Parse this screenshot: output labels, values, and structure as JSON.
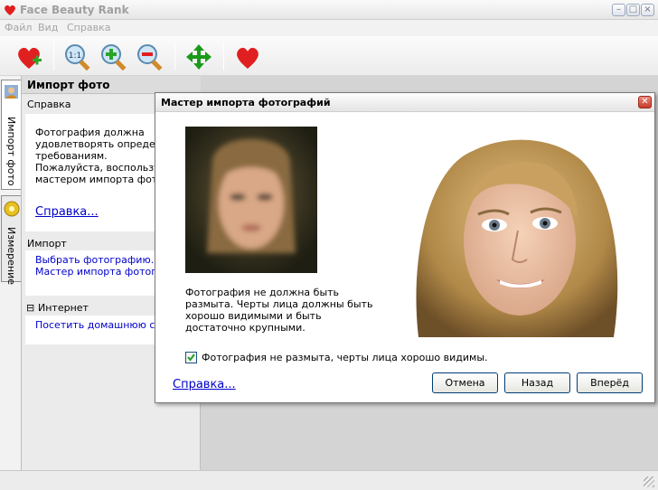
{
  "app": {
    "title": "Face Beauty Rank"
  },
  "menu": [
    "Файл",
    "Вид",
    "Справка"
  ],
  "toolbar": {
    "buttons": [
      "add-heart-icon",
      "zoom-actual-icon",
      "zoom-in-icon",
      "zoom-out-icon",
      "move-arrows-icon",
      "heart-icon"
    ]
  },
  "tabs": [
    {
      "label": "Импорт фото"
    },
    {
      "label": "Измерение"
    }
  ],
  "panel": {
    "header": "Импорт фото",
    "help": {
      "title": "Справка",
      "lines": [
        "Фотография должна",
        "удовлетворять определён",
        "требованиям.",
        "Пожалуйста, воспользуйт",
        "мастером импорта фотог"
      ],
      "link": "Справка..."
    },
    "import": {
      "title": "Импорт",
      "links": [
        "Выбрать фотографию...",
        "Мастер импорта фотогра"
      ]
    },
    "internet": {
      "toggle": "⊟",
      "title": "Интернет",
      "link": "Посетить домашнюю стра"
    }
  },
  "dialog": {
    "title": "Мастер импорта фотографий",
    "description": "Фотография не должна быть размыта. Черты лица должны быть хорошо видимыми и быть достаточно крупными.",
    "checkbox": {
      "checked": true,
      "label": "Фотография не размыта, черты лица хорошо видимы."
    },
    "help_link": "Справка...",
    "buttons": {
      "cancel": "Отмена",
      "back": "Назад",
      "next": "Вперёд"
    }
  },
  "colors": {
    "link": "#0000cc",
    "heart": "#e02020",
    "accent_green": "#1a9a1a"
  }
}
